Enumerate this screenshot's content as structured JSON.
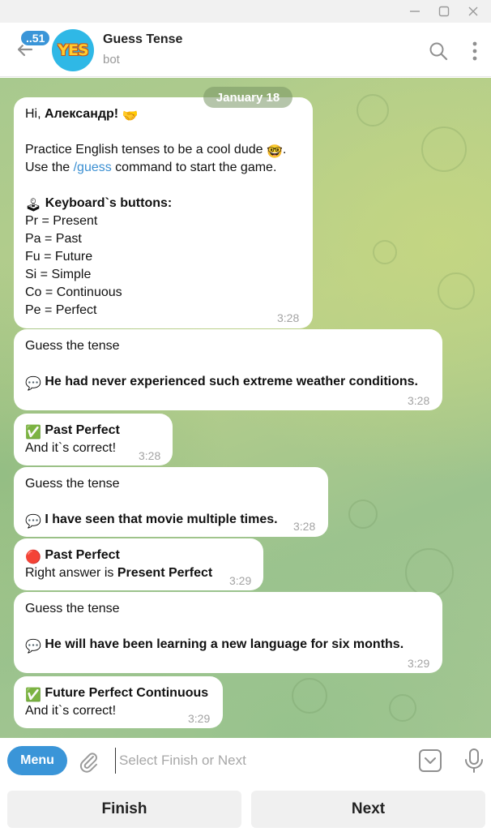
{
  "window": {
    "minimize_icon": "minimize-icon",
    "maximize_icon": "maximize-icon",
    "close_icon": "close-icon"
  },
  "header": {
    "unread_count": "..51",
    "avatar_text": "YES",
    "title": "Guess Tense",
    "subtitle": "bot"
  },
  "chat": {
    "date": "January 18",
    "messages": [
      {
        "greeting_prefix": "Hi, ",
        "greeting_name": "Александр!",
        "greeting_emoji": "🤝",
        "intro_line1": "Practice English tenses to be a cool dude ",
        "intro_emoji": "🤓",
        "intro_end": ".",
        "use_prefix": "Use the ",
        "command": "/guess",
        "use_suffix": " command to start the game.",
        "kb_emoji": "🕹",
        "kb_title": "Keyboard`s buttons:",
        "legend": [
          "Pr = Present",
          "Pa = Past",
          "Fu = Future",
          "Si = Simple",
          "Co = Continuous",
          "Pe = Perfect"
        ],
        "time": "3:28"
      },
      {
        "label": "Guess the tense",
        "emoji": "💬",
        "sentence": "He had never experienced such extreme weather conditions.",
        "time": "3:28"
      },
      {
        "emoji": "✅",
        "answer": "Past Perfect",
        "result": "And it`s correct!",
        "time": "3:28"
      },
      {
        "label": "Guess the tense",
        "emoji": "💬",
        "sentence": "I have seen that movie multiple times.",
        "time": "3:28"
      },
      {
        "emoji": "🔴",
        "answer": "Past Perfect",
        "result_prefix": "Right answer is ",
        "right_answer": "Present Perfect",
        "time": "3:29"
      },
      {
        "label": "Guess the tense",
        "emoji": "💬",
        "sentence": "He will have been learning a new language for six months.",
        "time": "3:29"
      },
      {
        "emoji": "✅",
        "answer": "Future Perfect Continuous",
        "result": "And it`s correct!",
        "time": "3:29"
      }
    ]
  },
  "composer": {
    "menu_label": "Menu",
    "placeholder": "Select Finish or Next",
    "value": ""
  },
  "keyboard": {
    "finish": "Finish",
    "next": "Next"
  },
  "colors": {
    "accent": "#3a95d8",
    "bubble": "#ffffff",
    "time": "#a3a3a3",
    "link": "#3a8fd2"
  }
}
